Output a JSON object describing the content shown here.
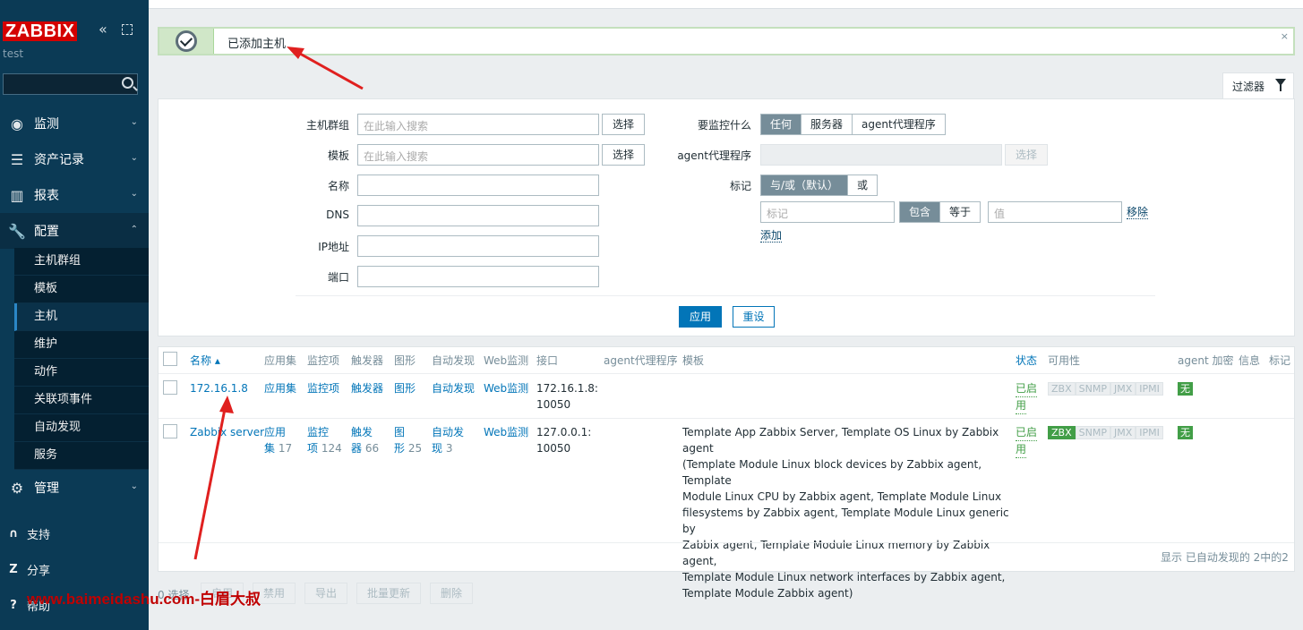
{
  "sidebar": {
    "logo": "ZABBIX",
    "server_name": "test",
    "menu": [
      {
        "label": "监测"
      },
      {
        "label": "资产记录"
      },
      {
        "label": "报表"
      },
      {
        "label": "配置"
      },
      {
        "label": "管理"
      }
    ],
    "submenu": [
      "主机群组",
      "模板",
      "主机",
      "维护",
      "动作",
      "关联项事件",
      "自动发现",
      "服务"
    ],
    "bottom": [
      {
        "label": "支持",
        "icon": "S"
      },
      {
        "label": "分享",
        "icon": "Z"
      },
      {
        "label": "帮助",
        "icon": "?"
      }
    ]
  },
  "message": {
    "text": "已添加主机",
    "close": "×"
  },
  "filter": {
    "tab_label": "过滤器",
    "host_groups_label": "主机群组",
    "templates_label": "模板",
    "name_label": "名称",
    "dns_label": "DNS",
    "ip_label": "IP地址",
    "port_label": "端口",
    "search_placeholder": "在此输入搜索",
    "select_label": "选择",
    "monitored_by_label": "要监控什么",
    "monitored_by_options": [
      "任何",
      "服务器",
      "agent代理程序"
    ],
    "proxy_label": "agent代理程序",
    "tags_label": "标记",
    "tags_mode": [
      "与/或（默认）",
      "或"
    ],
    "tag_placeholder": "标记",
    "tag_ops": [
      "包含",
      "等于"
    ],
    "value_placeholder": "值",
    "remove_label": "移除",
    "add_label": "添加",
    "apply_label": "应用",
    "reset_label": "重设"
  },
  "table": {
    "headers": {
      "name": "名称 ▴",
      "applications": "应用集",
      "items": "监控项",
      "triggers": "触发器",
      "graphs": "图形",
      "discovery": "自动发现",
      "web": "Web监测",
      "interface": "接口",
      "proxy": "agent代理程序",
      "templates": "模板",
      "status": "状态",
      "availability": "可用性",
      "encryption": "agent 加密",
      "info": "信息",
      "tags": "标记"
    },
    "rows": [
      {
        "name": "172.16.1.8",
        "applications": "应用集",
        "items": "监控项",
        "triggers": "触发器",
        "graphs": "图形",
        "discovery": "自动发现",
        "web": "Web监测",
        "interface_1": "172.16.1.8:",
        "interface_2": "10050",
        "status_1": "已启",
        "status_2": "用",
        "availability": [
          "ZBX",
          "SNMP",
          "JMX",
          "IPMI"
        ],
        "encryption": "无"
      },
      {
        "name": "Zabbix server",
        "applications_1": "应用",
        "applications_2": "集",
        "applications_count": "17",
        "items_1": "监控",
        "items_2": "项",
        "items_count": "124",
        "triggers_1": "触发",
        "triggers_2": "器",
        "triggers_count": "66",
        "graphs_1": "图",
        "graphs_2": "形",
        "graphs_count": "25",
        "discovery_1": "自动发",
        "discovery_2": "现",
        "discovery_count": "3",
        "web": "Web监测",
        "interface_1": "127.0.0.1:",
        "interface_2": "10050",
        "templates": [
          "Template App Zabbix Server, Template OS Linux by Zabbix agent",
          "(Template Module Linux block devices by Zabbix agent, Template",
          "Module Linux CPU by Zabbix agent, Template Module Linux",
          "filesystems by Zabbix agent, Template Module Linux generic by",
          "Zabbix agent, Template Module Linux memory by Zabbix agent,",
          "Template Module Linux network interfaces by Zabbix agent,",
          "Template Module Zabbix agent)"
        ],
        "status_1": "已启",
        "status_2": "用",
        "availability": [
          "ZBX",
          "SNMP",
          "JMX",
          "IPMI"
        ],
        "encryption": "无"
      }
    ],
    "footer": "显示 已自动发现的 2中的2"
  },
  "actions": {
    "selected": "0 选择",
    "buttons": [
      "启用",
      "禁用",
      "导出",
      "批量更新",
      "删除"
    ]
  },
  "watermark": "www.baimeidashu.com-白眉大叔",
  "colors": {
    "sidebar": "#0b3a55",
    "accent": "#0275b8",
    "success": "#429e47",
    "logo": "#d40000"
  }
}
